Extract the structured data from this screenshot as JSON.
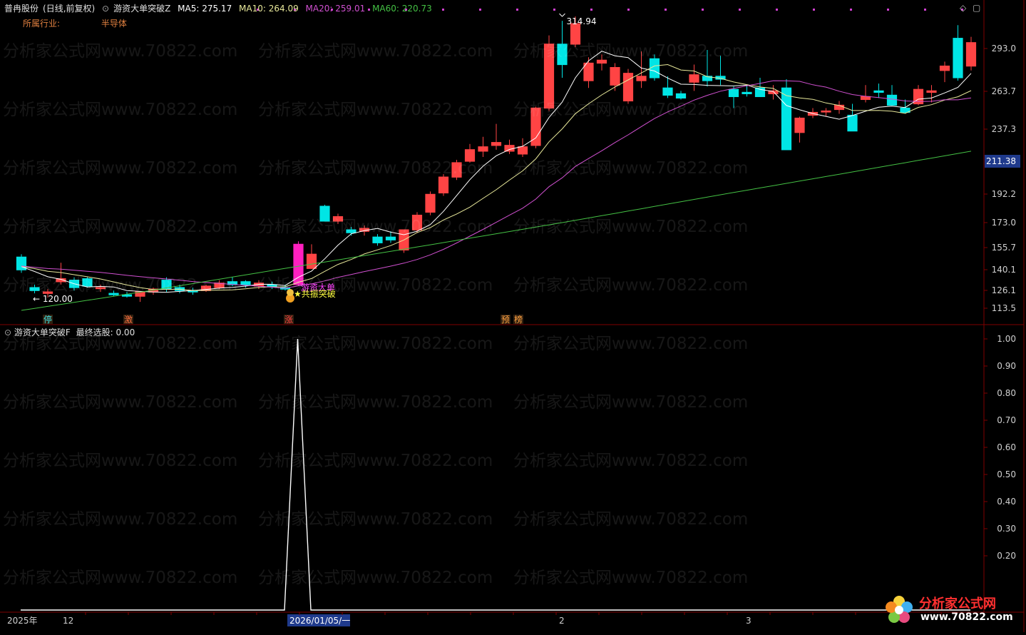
{
  "header": {
    "stock": "普冉股份",
    "period": "(日线,前复权)",
    "indicator": "游资大单突破Z",
    "ma5": "MA5: 275.17",
    "ma10": "MA10: 264.09",
    "ma20": "MA20: 259.01",
    "ma60": "MA60: 220.73",
    "industry_label": "所属行业:",
    "industry_value": "半导体"
  },
  "indicator_header": {
    "name": "游资大单突破F",
    "value": "最终选股: 0.00"
  },
  "colors": {
    "up": "#ff4444",
    "down": "#00e5e5",
    "ma5": "#ffffff",
    "ma10": "#e8e89a",
    "ma20": "#d050d0",
    "ma60": "#44c044",
    "axis": "#800000",
    "current_price_bg": "#1f3a8c"
  },
  "watermark": "分析家公式网www.70822.com",
  "logo": {
    "text": "分析家公式网",
    "url": "www.70822.com"
  },
  "chart_data": [
    {
      "type": "candlestick",
      "price_axis_ticks": [
        293.0,
        263.7,
        237.3,
        192.2,
        173.0,
        155.7,
        140.1,
        126.1,
        113.5
      ],
      "current_price_label": "211.38",
      "high_annotation": "314.94",
      "low_annotation": "120.00",
      "signal_labels": [
        "游资大单",
        "★共振突破"
      ],
      "event_markers": [
        "停",
        "激",
        "涨",
        "预",
        "榜"
      ],
      "candles": [
        [
          149,
          151,
          138,
          140
        ],
        [
          128,
          130,
          124,
          126
        ],
        [
          124,
          127,
          121,
          125
        ],
        [
          132,
          145,
          130,
          134
        ],
        [
          133,
          135,
          126,
          128
        ],
        [
          134,
          135,
          128,
          129
        ],
        [
          128,
          130,
          125,
          128
        ],
        [
          124,
          126,
          122,
          123
        ],
        [
          123,
          125,
          121,
          122
        ],
        [
          122,
          125,
          118,
          125
        ],
        [
          125,
          128,
          123,
          127
        ],
        [
          133,
          135,
          125,
          127
        ],
        [
          128,
          130,
          124,
          126
        ],
        [
          126,
          128,
          123,
          125
        ],
        [
          126,
          130,
          125,
          129
        ],
        [
          128,
          133,
          127,
          131
        ],
        [
          132,
          135,
          129,
          130
        ],
        [
          132,
          133,
          128,
          130
        ],
        [
          129,
          133,
          127,
          131
        ],
        [
          130,
          132,
          127,
          129
        ],
        [
          128,
          130,
          126,
          127
        ],
        [
          130,
          160,
          129,
          158
        ],
        [
          141,
          158,
          141,
          151
        ],
        [
          184,
          185,
          174,
          174
        ],
        [
          174,
          179,
          172,
          177
        ],
        [
          168,
          170,
          164,
          166
        ],
        [
          167,
          171,
          164,
          169
        ],
        [
          163,
          165,
          157,
          159
        ],
        [
          163,
          167,
          159,
          161
        ],
        [
          154,
          168,
          152,
          168
        ],
        [
          168,
          180,
          166,
          178
        ],
        [
          180,
          194,
          178,
          192
        ],
        [
          193,
          206,
          191,
          204
        ],
        [
          204,
          216,
          202,
          214
        ],
        [
          215,
          227,
          214,
          223
        ],
        [
          222,
          232,
          218,
          225
        ],
        [
          226,
          241,
          223,
          228
        ],
        [
          222,
          230,
          220,
          226
        ],
        [
          220,
          231,
          218,
          225
        ],
        [
          226,
          253,
          224,
          252
        ],
        [
          252,
          302,
          250,
          296
        ],
        [
          296,
          312,
          273,
          282
        ],
        [
          296,
          315,
          294,
          310
        ],
        [
          271,
          287,
          266,
          283
        ],
        [
          283,
          289,
          278,
          285
        ],
        [
          268,
          283,
          264,
          280
        ],
        [
          257,
          279,
          255,
          276
        ],
        [
          271,
          291,
          266,
          274
        ],
        [
          286,
          289,
          271,
          273
        ],
        [
          266,
          274,
          259,
          261
        ],
        [
          262,
          264,
          258,
          259
        ],
        [
          270,
          282,
          264,
          275
        ],
        [
          274,
          292,
          267,
          271
        ],
        [
          274,
          288,
          268,
          272
        ],
        [
          265,
          267,
          252,
          260
        ],
        [
          263,
          268,
          260,
          262
        ],
        [
          266,
          273,
          260,
          260
        ],
        [
          262,
          268,
          258,
          264
        ],
        [
          266,
          272,
          253,
          223
        ],
        [
          235,
          246,
          228,
          245
        ],
        [
          247,
          252,
          245,
          249
        ],
        [
          250,
          252,
          246,
          250
        ],
        [
          251,
          257,
          248,
          254
        ],
        [
          247,
          255,
          243,
          236
        ],
        [
          258,
          268,
          256,
          260
        ],
        [
          264,
          269,
          259,
          263
        ],
        [
          261,
          268,
          258,
          254
        ],
        [
          252,
          258,
          248,
          249
        ],
        [
          255,
          268,
          254,
          265
        ],
        [
          263,
          268,
          256,
          264
        ],
        [
          278,
          284,
          270,
          281
        ],
        [
          300,
          309,
          271,
          273
        ],
        [
          281,
          301,
          278,
          297
        ]
      ],
      "ma_series_note": "MA5, MA10, MA20, MA60 moving averages"
    },
    {
      "type": "line",
      "series": [
        {
          "name": "最终选股",
          "values": [
            0,
            0,
            0,
            0,
            0,
            0,
            0,
            0,
            0,
            0,
            0,
            0,
            0,
            0,
            0,
            0,
            0,
            0,
            0,
            0,
            0,
            1,
            0,
            0,
            0,
            0,
            0,
            0,
            0,
            0,
            0,
            0,
            0,
            0,
            0,
            0,
            0,
            0,
            0,
            0,
            0,
            0,
            0,
            0,
            0,
            0,
            0,
            0,
            0,
            0,
            0,
            0,
            0,
            0,
            0,
            0,
            0,
            0,
            0,
            0,
            0,
            0,
            0,
            0,
            0,
            0,
            0,
            0,
            0,
            0,
            0,
            0,
            0
          ]
        }
      ],
      "y_ticks": [
        1.0,
        0.9,
        0.8,
        0.7,
        0.6,
        0.5,
        0.4,
        0.3,
        0.2
      ]
    }
  ],
  "time_axis": {
    "labels": [
      "2025年",
      "12",
      "2026/01/05/一",
      "2",
      "3"
    ]
  }
}
